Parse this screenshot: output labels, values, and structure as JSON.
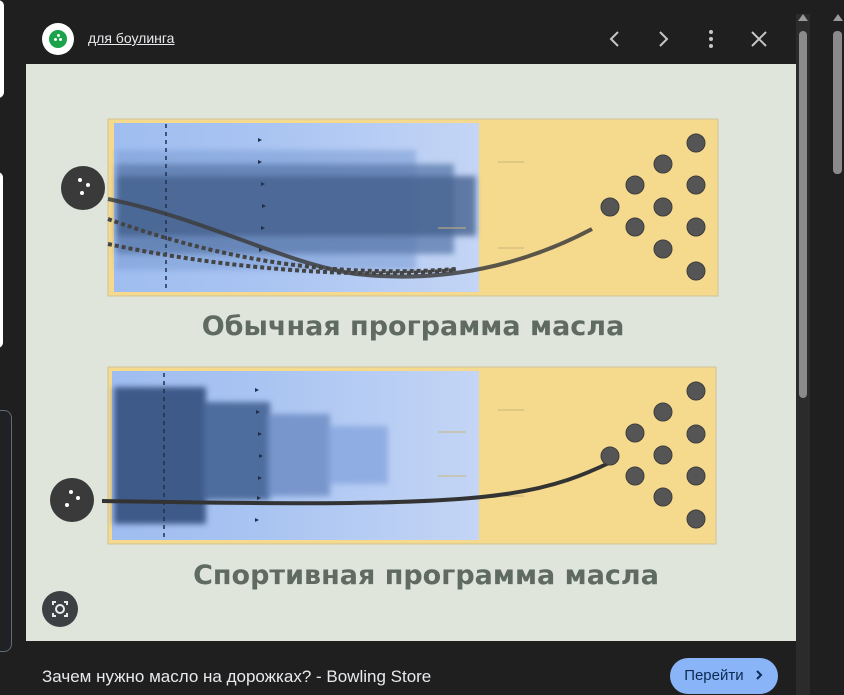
{
  "header": {
    "site_name": "для боулинга",
    "prev_icon": "chevron-left-icon",
    "next_icon": "chevron-right-icon",
    "more_icon": "more-vert-icon",
    "close_icon": "close-icon"
  },
  "image": {
    "top_label": "Обычная программа масла",
    "bottom_label": "Спортивная программа масла",
    "lens_icon": "lens-icon"
  },
  "footer": {
    "caption": "Зачем нужно масло на дорожках? - Bowling Store",
    "go_button": "Перейти",
    "go_icon": "chevron-right-icon"
  },
  "colors": {
    "accent": "#8ab4f8",
    "background": "#1f1f1f",
    "lane_wood": "#f5da8e",
    "oil_light": "#aec8f5",
    "oil_dark": "#4d6890",
    "label_text": "#5f6a60"
  }
}
